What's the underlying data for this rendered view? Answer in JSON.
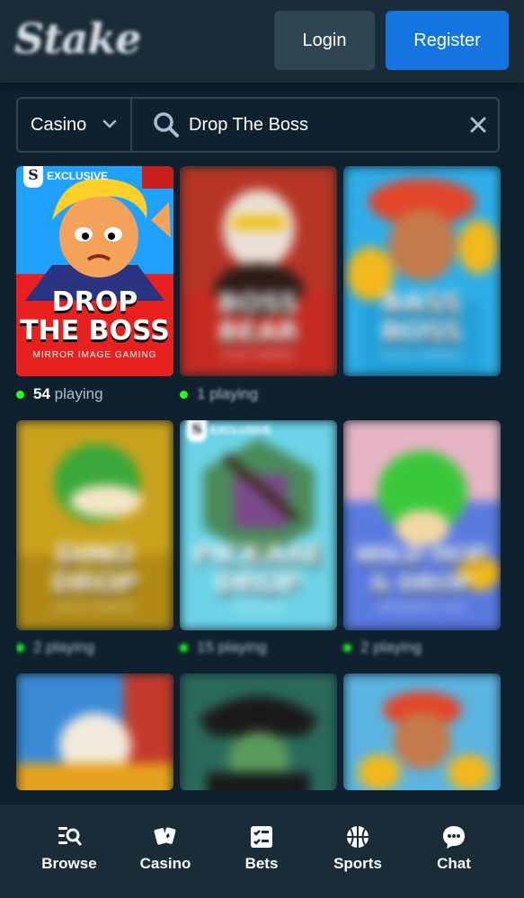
{
  "header": {
    "logo_text": "Stake",
    "login_label": "Login",
    "register_label": "Register"
  },
  "search": {
    "category": "Casino",
    "query": "Drop The Boss"
  },
  "games": [
    {
      "title_line1": "DROP",
      "title_line2": "THE BOSS",
      "provider": "MIRROR IMAGE GAMING",
      "badge": "EXCLUSIVE",
      "players": "54",
      "players_suffix": "playing"
    },
    {
      "title_line1": "BOSS",
      "title_line2": "BEAR",
      "provider": "PUSH GAMING",
      "players": "1",
      "players_suffix": "playing"
    },
    {
      "title_line1": "BASS",
      "title_line2": "BOSS",
      "provider": "RELAX GAMING",
      "players": "",
      "players_suffix": ""
    },
    {
      "title_line1": "DINO",
      "title_line2": "DROP",
      "provider": "RELAX GAMING",
      "players": "2",
      "players_suffix": "playing"
    },
    {
      "title_line1": "PICKAXE",
      "title_line2": "DROP",
      "provider": "HACKSAW",
      "badge": "EXCLUSIVE",
      "players": "15",
      "players_suffix": "playing"
    },
    {
      "title_line1": "WILD HOP",
      "title_line2": "& DROP",
      "provider": "PRAGMATIC PLAY",
      "players": "2",
      "players_suffix": "playing"
    },
    {
      "title_line1": "",
      "title_line2": "",
      "provider": "",
      "players": "",
      "players_suffix": ""
    },
    {
      "title_line1": "",
      "title_line2": "",
      "provider": "",
      "players": "",
      "players_suffix": ""
    },
    {
      "title_line1": "",
      "title_line2": "",
      "provider": "",
      "players": "",
      "players_suffix": ""
    }
  ],
  "bottom_nav": [
    {
      "label": "Browse",
      "icon": "browse-icon"
    },
    {
      "label": "Casino",
      "icon": "casino-cards-icon"
    },
    {
      "label": "Bets",
      "icon": "bets-checklist-icon"
    },
    {
      "label": "Sports",
      "icon": "basketball-icon"
    },
    {
      "label": "Chat",
      "icon": "chat-bubble-icon"
    }
  ],
  "colors": {
    "background": "#0f212e",
    "panel": "#1a2c38",
    "accent_blue": "#1475e1",
    "online_green": "#1fff20"
  }
}
